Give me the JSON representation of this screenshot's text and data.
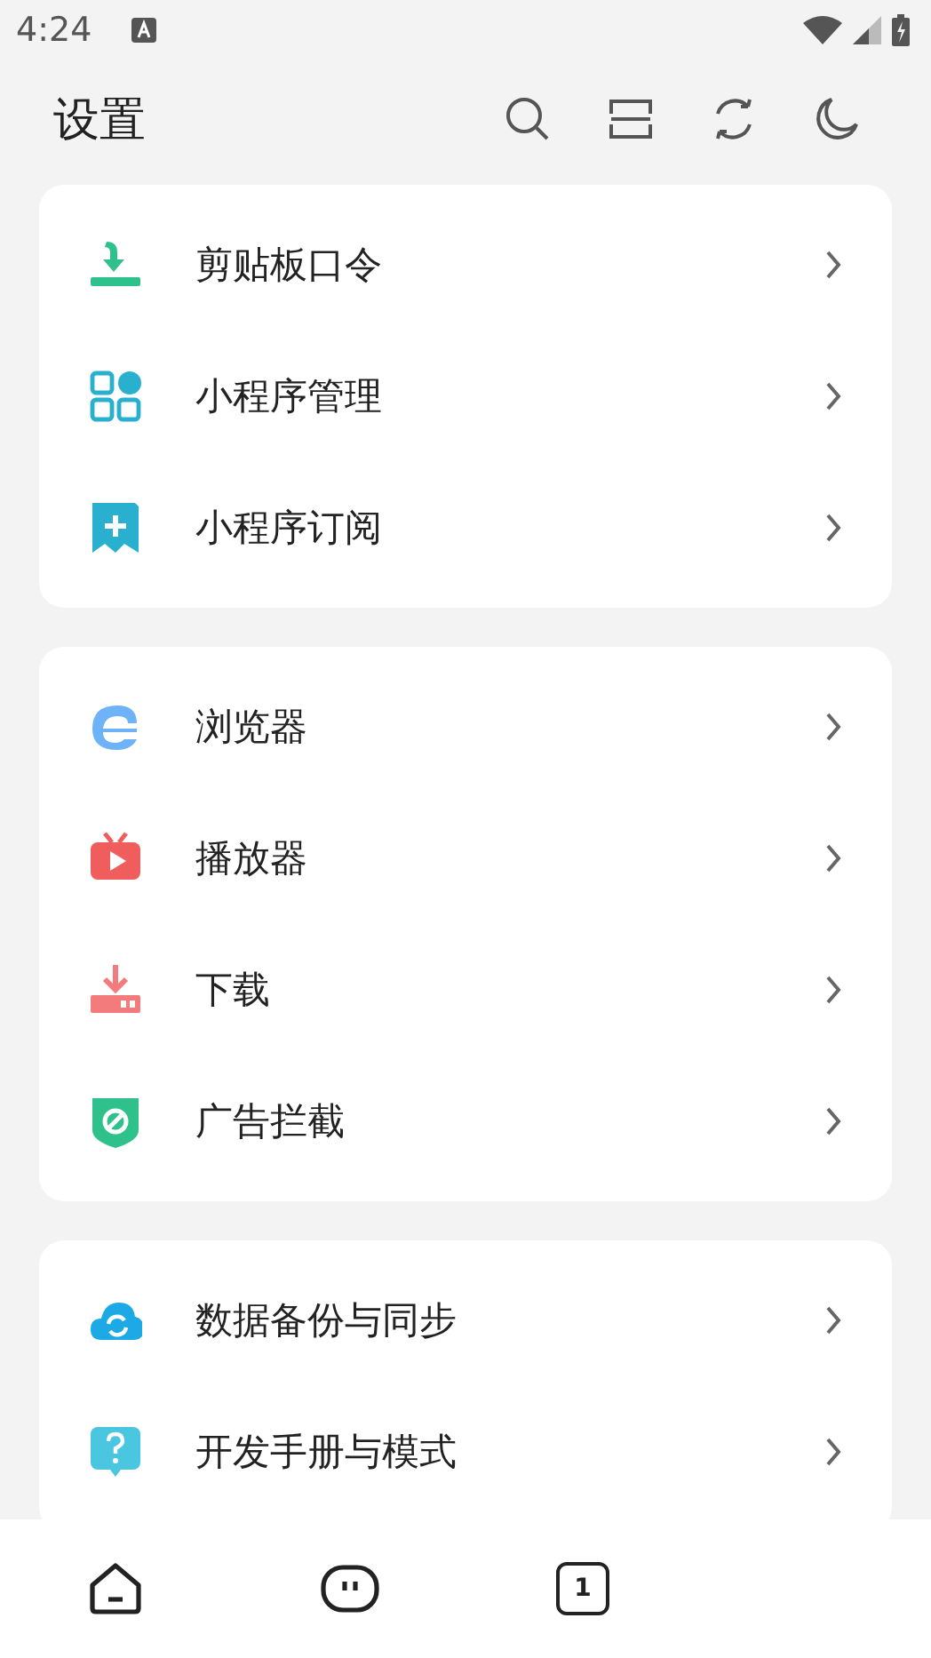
{
  "status_bar": {
    "time": "4:24"
  },
  "header": {
    "title": "设置"
  },
  "sections": [
    {
      "items": [
        {
          "label": "剪贴板口令"
        },
        {
          "label": "小程序管理"
        },
        {
          "label": "小程序订阅"
        }
      ]
    },
    {
      "items": [
        {
          "label": "浏览器"
        },
        {
          "label": "播放器"
        },
        {
          "label": "下载"
        },
        {
          "label": "广告拦截"
        }
      ]
    },
    {
      "items": [
        {
          "label": "数据备份与同步"
        },
        {
          "label": "开发手册与模式"
        }
      ]
    }
  ],
  "bottom_nav": {
    "tab_count": "1"
  }
}
